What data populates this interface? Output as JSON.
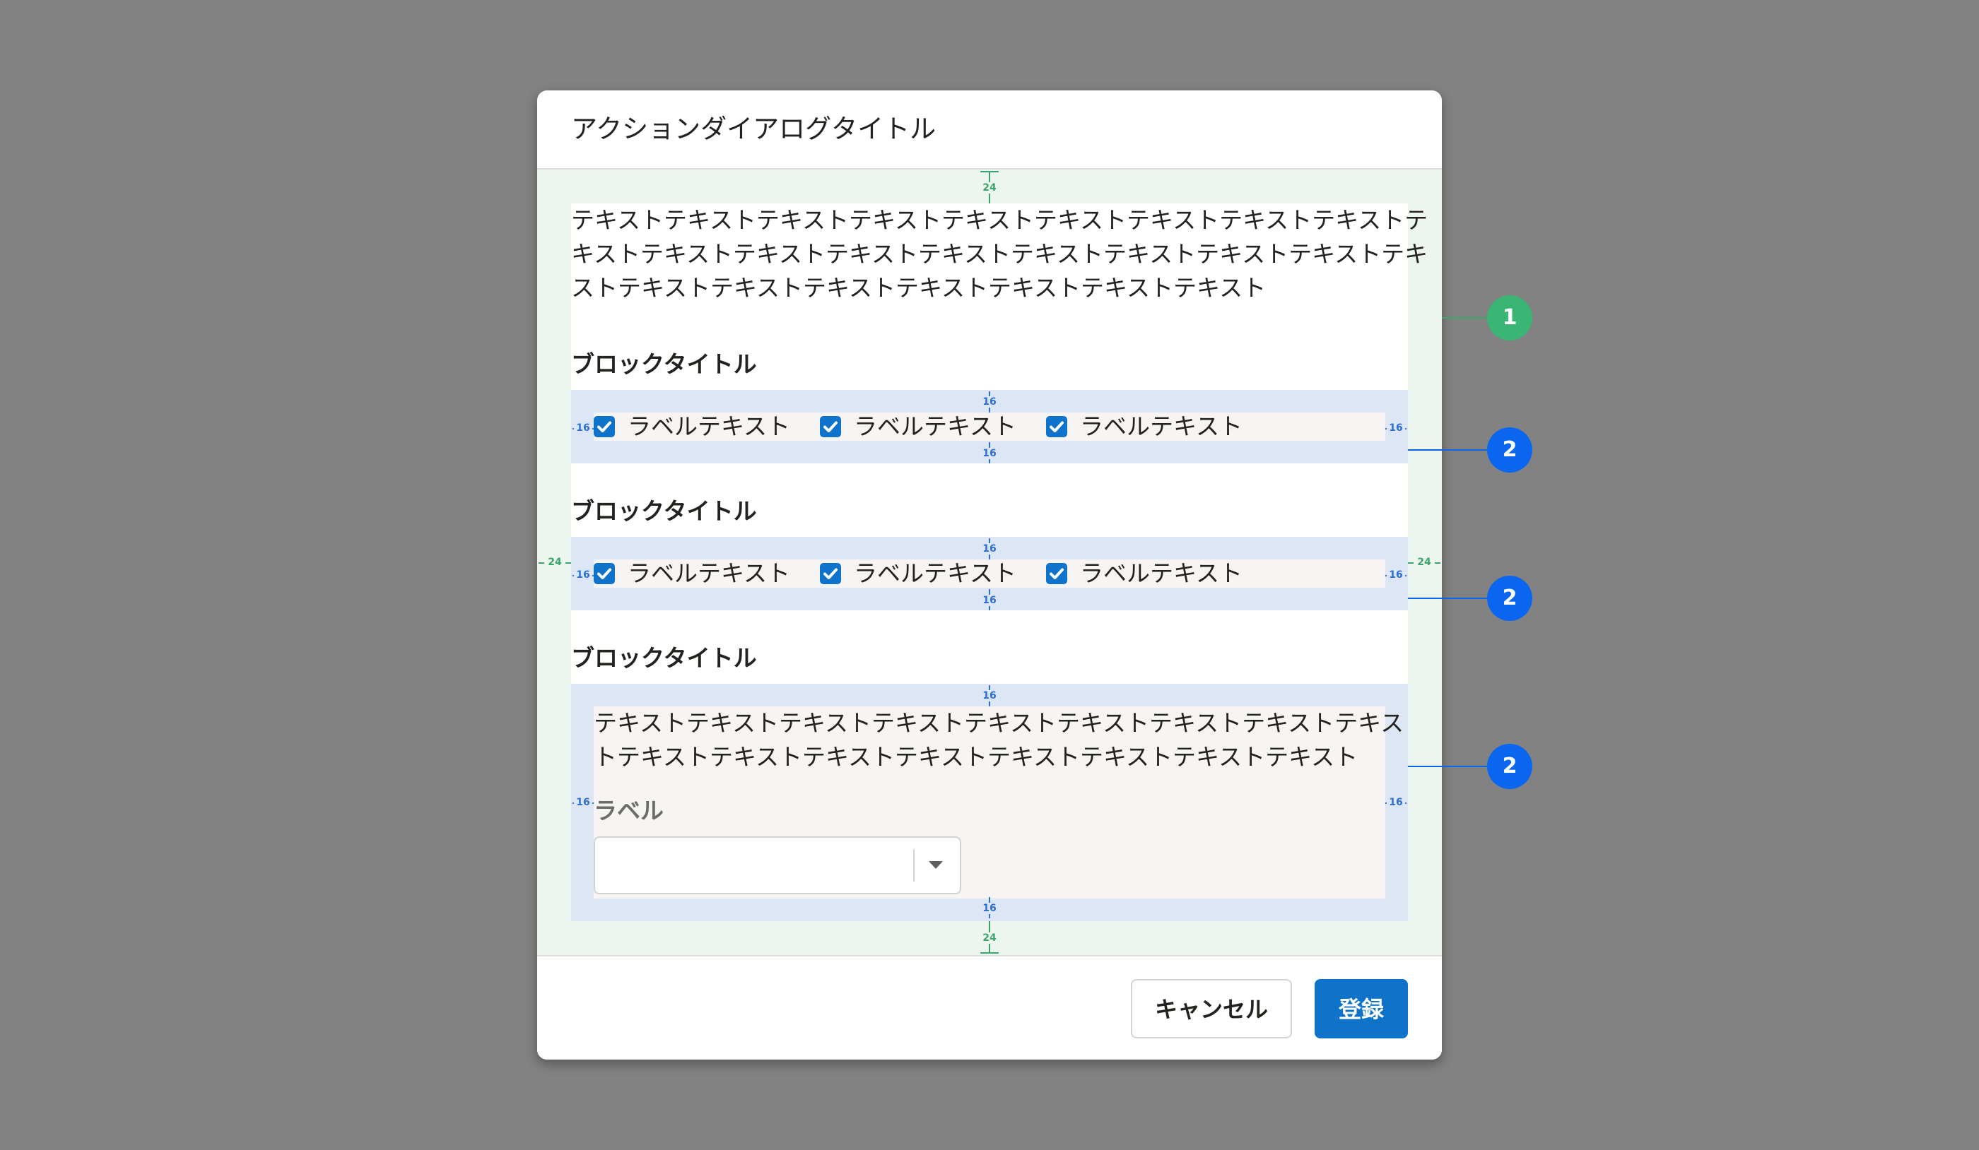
{
  "dialog": {
    "title": "アクションダイアログタイトル",
    "intro_lines": [
      "テキストテキストテキストテキストテキストテキストテキストテキストテキストテ",
      "キストテキストテキストテキストテキストテキストテキストテキストテキストテキ",
      "ストテキストテキストテキストテキストテキストテキストテキスト"
    ],
    "blocks": [
      {
        "title": "ブロックタイトル",
        "checkboxes": [
          "ラベルテキスト",
          "ラベルテキスト",
          "ラベルテキスト"
        ]
      },
      {
        "title": "ブロックタイトル",
        "checkboxes": [
          "ラベルテキスト",
          "ラベルテキスト",
          "ラベルテキスト"
        ]
      },
      {
        "title": "ブロックタイトル",
        "text_lines": [
          "テキストテキストテキストテキストテキストテキストテキストテキストテキス",
          "トテキストテキストテキストテキストテキストテキストテキストテキスト"
        ],
        "field_label": "ラベル",
        "select_value": ""
      }
    ],
    "footer": {
      "cancel_label": "キャンセル",
      "submit_label": "登録"
    }
  },
  "spacing": {
    "outer": "24",
    "inner": "16"
  },
  "callouts": [
    "1",
    "2",
    "2",
    "2"
  ],
  "colors": {
    "accent": "#0f73c9",
    "callout_green": "#3bb574",
    "callout_blue": "#0a66f0",
    "spacing_green": "#3aa66a",
    "spacing_blue": "#2c6fd6"
  }
}
